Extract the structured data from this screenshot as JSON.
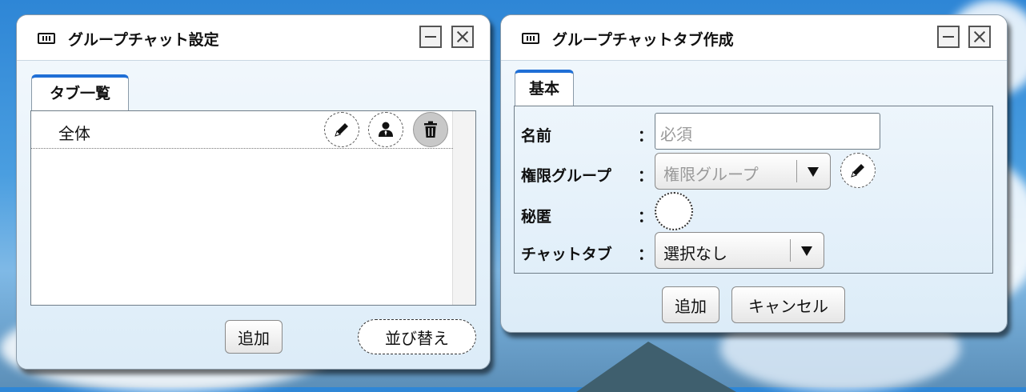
{
  "settings_window": {
    "title": "グループチャット設定",
    "tab_label": "タブ一覧",
    "rows": [
      {
        "name": "全体"
      }
    ],
    "add_button": "追加",
    "sort_button": "並び替え"
  },
  "create_window": {
    "title": "グループチャットタブ作成",
    "tab_label": "基本",
    "fields": {
      "name_label": "名前",
      "name_placeholder": "必須",
      "permission_label": "権限グループ",
      "permission_value": "権限グループ",
      "secret_label": "秘匿",
      "chat_tab_label": "チャットタブ",
      "chat_tab_value": "選択なし",
      "colon": "："
    },
    "add_button": "追加",
    "cancel_button": "キャンセル"
  },
  "icons": {
    "keyboard": "keyboard-icon",
    "edit": "pencil-icon",
    "permission": "person-icon",
    "delete": "trash-icon"
  },
  "colors": {
    "tab_accent": "#1f6fd6",
    "delete_bg": "#c8c8c8"
  }
}
